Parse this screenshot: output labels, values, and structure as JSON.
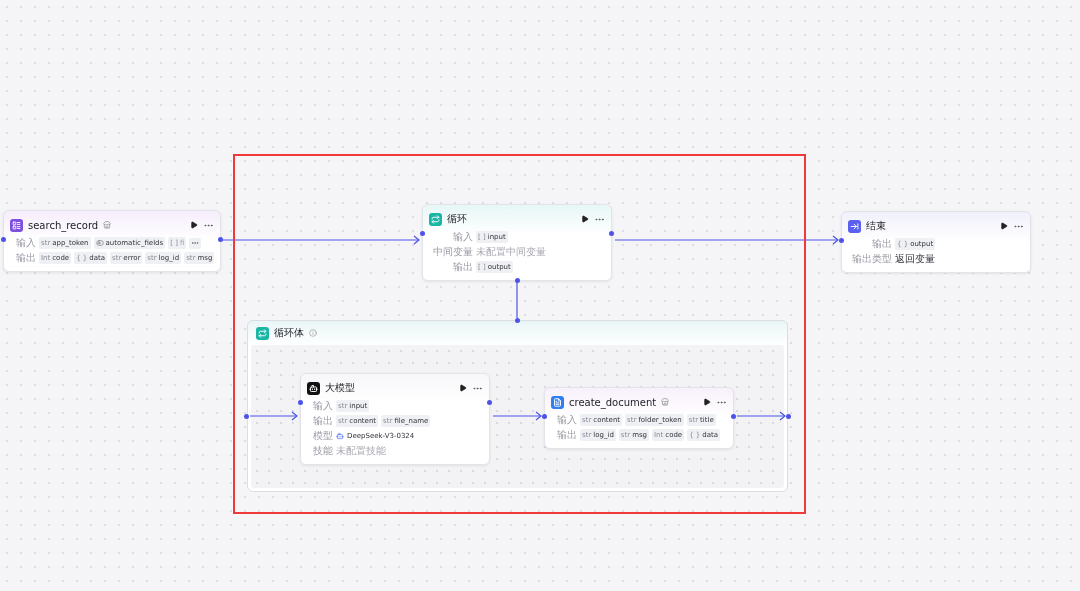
{
  "nodes": [
    {
      "kind": "plugin",
      "title": "search_record",
      "plugin_badge": true,
      "rows": [
        {
          "label": "输入",
          "tags": [
            {
              "type": "str",
              "name": "app_token"
            },
            {
              "kind": "toggle",
              "name": "automatic_fields"
            },
            {
              "type": "[ ]",
              "name": "fi",
              "disabled": true
            }
          ],
          "more": true
        },
        {
          "label": "输出",
          "tags": [
            {
              "type": "Int",
              "name": "code"
            },
            {
              "type": "{ }",
              "name": "data"
            },
            {
              "type": "str",
              "name": "error"
            },
            {
              "type": "str",
              "name": "log_id"
            },
            {
              "type": "str",
              "name": "msg"
            }
          ]
        }
      ]
    },
    {
      "kind": "loop",
      "title": "循环",
      "plugin_badge": false,
      "rows": [
        {
          "label": "输入",
          "tags": [
            {
              "type": "[ ]",
              "name": "input"
            }
          ]
        },
        {
          "label": "中间变量",
          "text": "未配置中间变量",
          "muted": true
        },
        {
          "label": "输出",
          "tags": [
            {
              "type": "[ ]",
              "name": "output"
            }
          ]
        }
      ]
    },
    {
      "kind": "end",
      "title": "结束",
      "plugin_badge": false,
      "rows": [
        {
          "label": "输出",
          "tags": [
            {
              "type": "{ }",
              "name": "output"
            }
          ]
        },
        {
          "label": "输出类型",
          "text": "返回变量",
          "muted": false
        }
      ]
    },
    {
      "kind": "llm",
      "title": "大模型",
      "plugin_badge": false,
      "rows": [
        {
          "label": "输入",
          "tags": [
            {
              "type": "str",
              "name": "input"
            }
          ]
        },
        {
          "label": "输出",
          "tags": [
            {
              "type": "str",
              "name": "content"
            },
            {
              "type": "str",
              "name": "file_name"
            }
          ]
        },
        {
          "label": "模型",
          "model": "DeepSeek-V3-0324"
        },
        {
          "label": "技能",
          "text": "未配置技能",
          "muted": true
        }
      ]
    },
    {
      "kind": "doc",
      "title": "create_document",
      "plugin_badge": true,
      "rows": [
        {
          "label": "输入",
          "tags": [
            {
              "type": "str",
              "name": "content"
            },
            {
              "type": "str",
              "name": "folder_token"
            },
            {
              "type": "str",
              "name": "title"
            }
          ]
        },
        {
          "label": "输出",
          "tags": [
            {
              "type": "str",
              "name": "log_id"
            },
            {
              "type": "str",
              "name": "msg"
            },
            {
              "type": "Int",
              "name": "code"
            },
            {
              "type": "{ }",
              "name": "data"
            }
          ]
        }
      ]
    }
  ],
  "loop_body": {
    "title": "循环体"
  },
  "annotation": {
    "kind": "frame"
  }
}
